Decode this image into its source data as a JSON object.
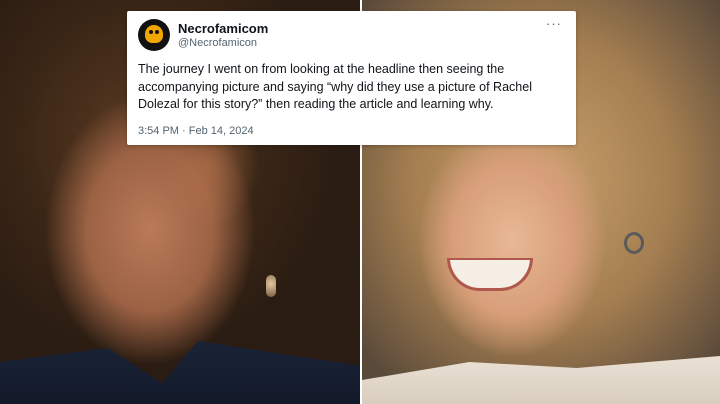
{
  "tweet": {
    "author_name": "Necrofamicom",
    "author_handle": "@Necrofamicon",
    "more_label": "···",
    "text": "The journey I went on from looking at the headline then seeing the accompanying picture and saying “why did they use a picture of Rachel Dolezal for this story?” then reading the article and learning why.",
    "timestamp": "3:54 PM · Feb 14, 2024"
  },
  "icons": {
    "avatar": "avatar-icon",
    "more": "more-options-icon"
  },
  "colors": {
    "card_background": "#ffffff",
    "primary_text": "#0f1419",
    "secondary_text": "#536471"
  }
}
